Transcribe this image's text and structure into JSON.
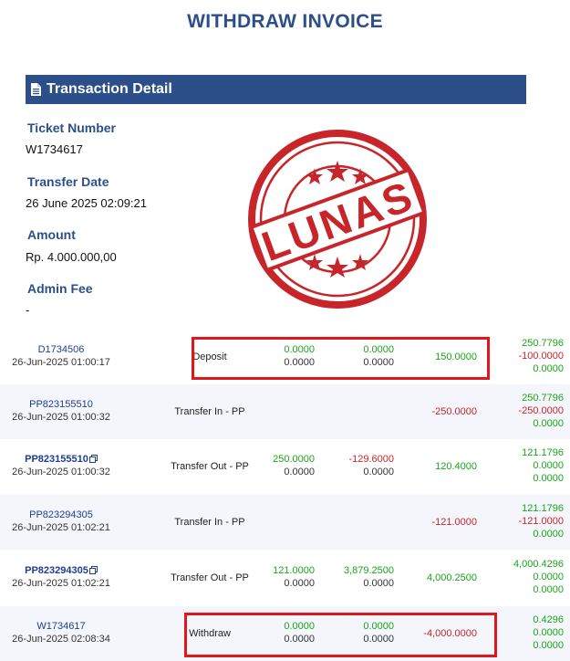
{
  "title": "WITHDRAW INVOICE",
  "section": {
    "title": "Transaction Detail",
    "icon": "document-icon"
  },
  "fields": [
    {
      "label": "Ticket Number",
      "value": "W1734617"
    },
    {
      "label": "Transfer Date",
      "value": "26 June 2025 02:09:21"
    },
    {
      "label": "Amount",
      "value": "Rp. 4.000.000,00"
    },
    {
      "label": "Admin Fee",
      "value": "-"
    }
  ],
  "stamp": {
    "text": "LUNAS",
    "color": "#c8252b"
  },
  "colors": {
    "accent": "#2c4f8a",
    "positive": "#1aa51a",
    "negative": "#c8252b",
    "highlight": "#e1161b"
  },
  "rows": [
    {
      "id": "D1734506",
      "id_bold": false,
      "copy_icon": false,
      "time": "26-Jun-2025 01:00:17",
      "type": "Deposit",
      "c1": [
        "0.0000",
        "0.0000"
      ],
      "c2": [
        "0.0000",
        "0.0000"
      ],
      "c3": "150.0000",
      "c4": [
        "250.7796",
        "-100.0000",
        "0.0000"
      ]
    },
    {
      "id": "PP823155510",
      "id_bold": false,
      "copy_icon": false,
      "time": "26-Jun-2025 01:00:32",
      "type": "Transfer In - PP",
      "c1": [],
      "c2": [],
      "c3": "-250.0000",
      "c4": [
        "250.7796",
        "-250.0000",
        "0.0000"
      ]
    },
    {
      "id": "PP823155510",
      "id_bold": true,
      "copy_icon": true,
      "time": "26-Jun-2025 01:00:32",
      "type": "Transfer Out - PP",
      "c1": [
        "250.0000",
        "0.0000"
      ],
      "c2": [
        "-129.6000",
        "0.0000"
      ],
      "c3": "120.4000",
      "c4": [
        "121.1796",
        "0.0000",
        "0.0000"
      ]
    },
    {
      "id": "PP823294305",
      "id_bold": false,
      "copy_icon": false,
      "time": "26-Jun-2025 01:02:21",
      "type": "Transfer In - PP",
      "c1": [],
      "c2": [],
      "c3": "-121.0000",
      "c4": [
        "121.1796",
        "-121.0000",
        "0.0000"
      ]
    },
    {
      "id": "PP823294305",
      "id_bold": true,
      "copy_icon": true,
      "time": "26-Jun-2025 01:02:21",
      "type": "Transfer Out - PP",
      "c1": [
        "121.0000",
        "0.0000"
      ],
      "c2": [
        "3,879.2500",
        "0.0000"
      ],
      "c3": "4,000.2500",
      "c4": [
        "4,000.4296",
        "0.0000",
        "0.0000"
      ]
    },
    {
      "id": "W1734617",
      "id_bold": false,
      "copy_icon": false,
      "time": "26-Jun-2025 02:08:34",
      "type": "Withdraw",
      "c1": [
        "0.0000",
        "0.0000"
      ],
      "c2": [
        "0.0000",
        "0.0000"
      ],
      "c3": "-4,000.0000",
      "c4": [
        "0.4296",
        "0.0000",
        "0.0000"
      ]
    }
  ]
}
